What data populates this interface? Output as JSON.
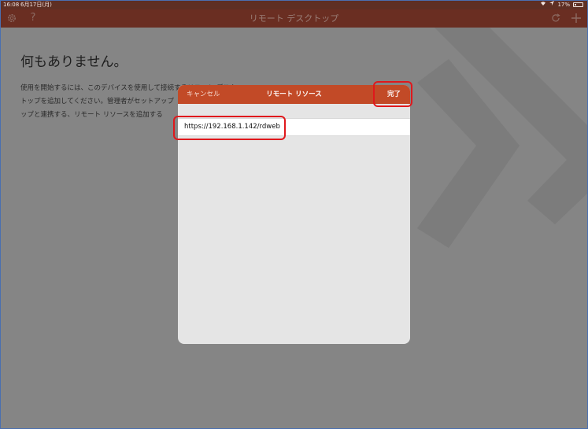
{
  "status_bar": {
    "time": "16:08",
    "date": "6月17日(月)",
    "battery": "17%",
    "battery_level": 0.17
  },
  "nav_bar": {
    "title": "リモート デスクトップ",
    "left_icons": [
      "gear-icon",
      "help-icon"
    ],
    "right_icons": [
      "refresh-icon",
      "plus-icon"
    ]
  },
  "background": {
    "heading": "何もありません。",
    "description_lines": [
      "使用を開始するには、このデバイスを使用して接続するリモート デスク",
      "トップを追加してください。管理者がセットアップ",
      "ップと連携する、リモート リソースを追加する"
    ]
  },
  "modal": {
    "cancel_label": "キャンセル",
    "title": "リモート リソース",
    "done_label": "完了",
    "url_value": "https://192.168.1.142/rdweb"
  },
  "colors": {
    "status_bar": "#5e2f24",
    "nav_bar": "#6a2e22",
    "modal_header": "#c24a27",
    "callout": "#e0181c",
    "backdrop": "#858585"
  }
}
